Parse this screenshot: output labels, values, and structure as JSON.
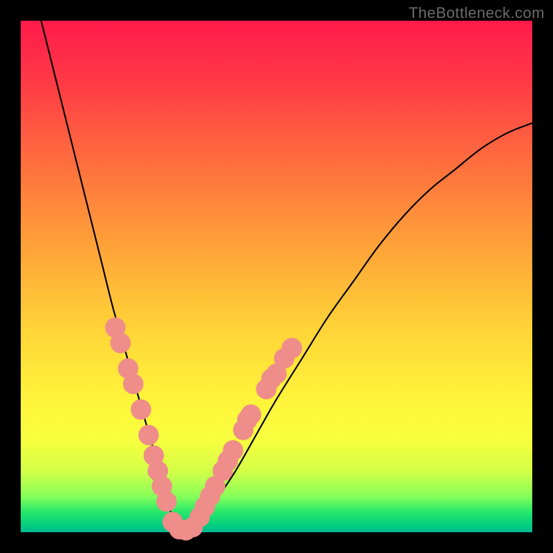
{
  "watermark": "TheBottleneck.com",
  "chart_data": {
    "type": "line",
    "title": "",
    "xlabel": "",
    "ylabel": "",
    "xlim": [
      0,
      100
    ],
    "ylim": [
      0,
      100
    ],
    "legend": false,
    "grid": false,
    "series": [
      {
        "name": "bottleneck-curve",
        "x": [
          4,
          6,
          8,
          10,
          12,
          14,
          16,
          18,
          20,
          22,
          24,
          26,
          27,
          28,
          29,
          30,
          31,
          32,
          34,
          36,
          38,
          42,
          46,
          50,
          55,
          60,
          65,
          70,
          75,
          80,
          85,
          90,
          95,
          100
        ],
        "y": [
          100,
          92,
          84,
          76,
          68,
          60,
          52,
          44,
          37,
          30,
          23,
          16,
          12,
          8,
          5,
          2,
          1,
          0,
          1,
          3,
          6,
          12,
          19,
          26,
          34,
          42,
          49,
          56,
          62,
          67,
          71,
          75,
          78,
          80
        ],
        "color": "#000000",
        "width": 2.2
      }
    ],
    "markers": [
      {
        "name": "left-dot-1",
        "x": 18.5,
        "y": 40,
        "r": 2.0,
        "color": "#ef8d8a"
      },
      {
        "name": "left-dot-2",
        "x": 19.5,
        "y": 37,
        "r": 2.0,
        "color": "#ef8d8a"
      },
      {
        "name": "left-dot-3",
        "x": 21.0,
        "y": 32,
        "r": 2.0,
        "color": "#ef8d8a"
      },
      {
        "name": "left-dot-4",
        "x": 22.0,
        "y": 29,
        "r": 2.0,
        "color": "#ef8d8a"
      },
      {
        "name": "left-dot-5",
        "x": 23.5,
        "y": 24,
        "r": 2.0,
        "color": "#ef8d8a"
      },
      {
        "name": "left-dot-6",
        "x": 25.0,
        "y": 19,
        "r": 2.0,
        "color": "#ef8d8a"
      },
      {
        "name": "left-dot-7",
        "x": 26.0,
        "y": 15,
        "r": 2.0,
        "color": "#ef8d8a"
      },
      {
        "name": "left-dot-8",
        "x": 26.8,
        "y": 12,
        "r": 2.0,
        "color": "#ef8d8a"
      },
      {
        "name": "left-dot-9",
        "x": 27.6,
        "y": 9,
        "r": 2.0,
        "color": "#ef8d8a"
      },
      {
        "name": "left-dot-10",
        "x": 28.5,
        "y": 6,
        "r": 2.0,
        "color": "#ef8d8a"
      },
      {
        "name": "bottom-dot-1",
        "x": 29.7,
        "y": 2.0,
        "r": 2.0,
        "color": "#ef8d8a"
      },
      {
        "name": "bottom-dot-2",
        "x": 31.0,
        "y": 0.6,
        "r": 2.0,
        "color": "#ef8d8a"
      },
      {
        "name": "bottom-dot-3",
        "x": 32.3,
        "y": 0.4,
        "r": 2.0,
        "color": "#ef8d8a"
      },
      {
        "name": "bottom-dot-4",
        "x": 33.6,
        "y": 1.0,
        "r": 2.0,
        "color": "#ef8d8a"
      },
      {
        "name": "right-dot-1",
        "x": 35.0,
        "y": 3,
        "r": 2.0,
        "color": "#ef8d8a"
      },
      {
        "name": "right-dot-2",
        "x": 36.0,
        "y": 5,
        "r": 2.0,
        "color": "#ef8d8a"
      },
      {
        "name": "right-dot-3",
        "x": 37.0,
        "y": 7,
        "r": 2.0,
        "color": "#ef8d8a"
      },
      {
        "name": "right-dot-4",
        "x": 38.0,
        "y": 9,
        "r": 2.0,
        "color": "#ef8d8a"
      },
      {
        "name": "right-dot-5",
        "x": 39.5,
        "y": 12,
        "r": 2.0,
        "color": "#ef8d8a"
      },
      {
        "name": "right-dot-6",
        "x": 40.5,
        "y": 14,
        "r": 2.0,
        "color": "#ef8d8a"
      },
      {
        "name": "right-dot-7",
        "x": 41.5,
        "y": 16,
        "r": 2.0,
        "color": "#ef8d8a"
      },
      {
        "name": "right-dot-8",
        "x": 43.5,
        "y": 20,
        "r": 2.0,
        "color": "#ef8d8a"
      },
      {
        "name": "right-dot-9",
        "x": 44.3,
        "y": 22,
        "r": 2.0,
        "color": "#ef8d8a"
      },
      {
        "name": "right-dot-10",
        "x": 45.0,
        "y": 23,
        "r": 2.0,
        "color": "#ef8d8a"
      },
      {
        "name": "right-dot-11",
        "x": 48.0,
        "y": 28,
        "r": 2.0,
        "color": "#ef8d8a"
      },
      {
        "name": "right-dot-12",
        "x": 49.0,
        "y": 30,
        "r": 2.0,
        "color": "#ef8d8a"
      },
      {
        "name": "right-dot-13",
        "x": 50.0,
        "y": 31,
        "r": 2.0,
        "color": "#ef8d8a"
      },
      {
        "name": "right-dot-14",
        "x": 51.5,
        "y": 34,
        "r": 2.0,
        "color": "#ef8d8a"
      },
      {
        "name": "right-dot-15",
        "x": 53.0,
        "y": 36,
        "r": 2.0,
        "color": "#ef8d8a"
      }
    ]
  }
}
